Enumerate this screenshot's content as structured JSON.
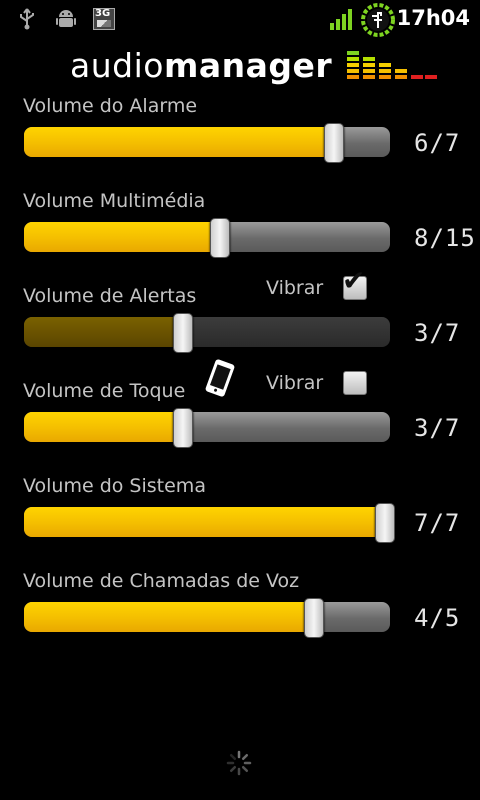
{
  "status_bar": {
    "time": "17h04",
    "network_badge": "3G",
    "icons": [
      "usb-icon",
      "android-debug-icon",
      "3g-icon",
      "signal-icon",
      "battery-charging-icon"
    ]
  },
  "header": {
    "logo_light": "audio",
    "logo_bold": "manager"
  },
  "volumes": [
    {
      "label": "Volume do Alarme",
      "value_text": "6/7",
      "level": 6,
      "max": 7,
      "enabled": true
    },
    {
      "label": "Volume Multimédia",
      "value_text": "8/15",
      "level": 8,
      "max": 15,
      "enabled": true
    },
    {
      "label": "Volume de Alertas",
      "value_text": "3/7",
      "level": 3,
      "max": 7,
      "enabled": false,
      "vibrate": {
        "label": "Vibrar",
        "checked": true
      }
    },
    {
      "label": "Volume de Toque",
      "value_text": "3/7",
      "level": 3,
      "max": 7,
      "enabled": true,
      "vibrate": {
        "label": "Vibrar",
        "checked": false
      }
    },
    {
      "label": "Volume do Sistema",
      "value_text": "7/7",
      "level": 7,
      "max": 7,
      "enabled": true
    },
    {
      "label": "Volume de Chamadas de Voz",
      "value_text": "4/5",
      "level": 4,
      "max": 5,
      "enabled": true
    }
  ],
  "colors": {
    "accent": "#f5c000",
    "background": "#000000",
    "text": "#c4c4c4",
    "battery_ring": "#7ed321"
  }
}
